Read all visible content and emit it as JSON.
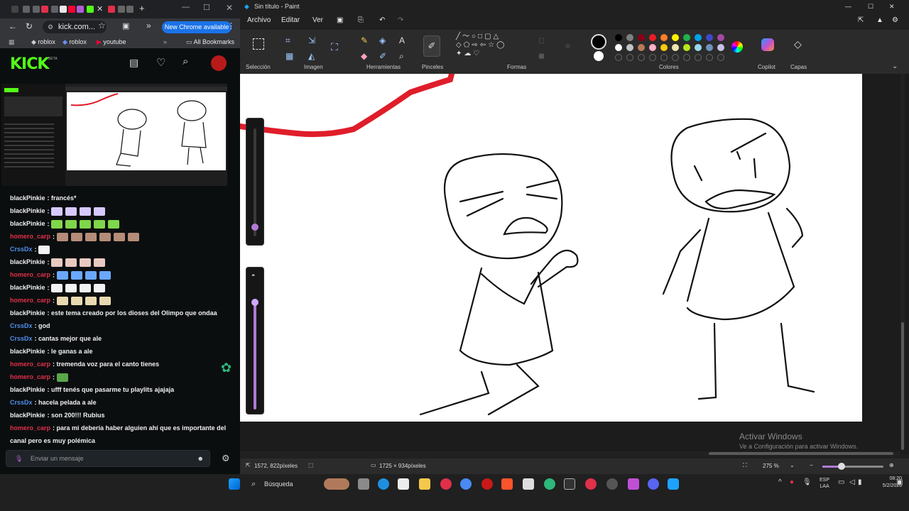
{
  "chrome": {
    "url": "kick.com...",
    "update_button": "New Chrome available",
    "bookmarks": [
      "roblox",
      "roblox",
      "youtube"
    ],
    "all_bookmarks": "All Bookmarks"
  },
  "kick": {
    "logo": "KICK",
    "beta": "BETA",
    "brand_color": "#53fc18",
    "chat_placeholder": "Enviar un mensaje",
    "messages": [
      {
        "user": "blackPinkie",
        "color": "#f0f0f0",
        "text": "francés*",
        "emotes": 0
      },
      {
        "user": "blackPinkie",
        "color": "#f0f0f0",
        "text": "",
        "emotes": 4,
        "emote_color": "#d6c9ff"
      },
      {
        "user": "blackPinkie",
        "color": "#f0f0f0",
        "text": "",
        "emotes": 5,
        "emote_color": "#7fd64a"
      },
      {
        "user": "homero_carp",
        "color": "#e0304a",
        "text": "",
        "emotes": 6,
        "emote_color": "#b48c78"
      },
      {
        "user": "CrssDx",
        "color": "#4f8fe8",
        "text": "",
        "emotes": 1,
        "emote_color": "#f2f2f2"
      },
      {
        "user": "blackPinkie",
        "color": "#f0f0f0",
        "text": "",
        "emotes": 4,
        "emote_color": "#e8c9c0"
      },
      {
        "user": "homero_carp",
        "color": "#e0304a",
        "text": "",
        "emotes": 4,
        "emote_color": "#6aa8ff"
      },
      {
        "user": "blackPinkie",
        "color": "#f0f0f0",
        "text": "",
        "emotes": 4,
        "emote_color": "#f2f2f2"
      },
      {
        "user": "homero_carp",
        "color": "#e0304a",
        "text": "",
        "emotes": 4,
        "emote_color": "#e8d9b0"
      },
      {
        "user": "blackPinkie",
        "color": "#f0f0f0",
        "text": "este tema creado por los dioses del Olimpo que ondaa",
        "emotes": 0
      },
      {
        "user": "CrssDx",
        "color": "#4f8fe8",
        "text": "god",
        "emotes": 0
      },
      {
        "user": "CrssDx",
        "color": "#4f8fe8",
        "text": "cantas mejor que ale",
        "emotes": 0
      },
      {
        "user": "blackPinkie",
        "color": "#f0f0f0",
        "text": "le ganas a ale",
        "emotes": 0
      },
      {
        "user": "homero_carp",
        "color": "#e0304a",
        "text": "tremenda voz para el canto tienes",
        "emotes": 0
      },
      {
        "user": "homero_carp",
        "color": "#e0304a",
        "text": "",
        "emotes": 1,
        "emote_color": "#5aa84a"
      },
      {
        "user": "blackPinkie",
        "color": "#f0f0f0",
        "text": "ufff tenés que pasarme tu playlits ajajaja",
        "emotes": 0
      },
      {
        "user": "CrssDx",
        "color": "#4f8fe8",
        "text": "hacela pelada a ale",
        "emotes": 0
      },
      {
        "user": "blackPinkie",
        "color": "#f0f0f0",
        "text": "son 200!!! Rubius",
        "emotes": 0
      },
      {
        "user": "homero_carp",
        "color": "#e0304a",
        "text": "para mi debería haber alguien ahí que es importante del",
        "emotes": 0
      },
      {
        "user": "",
        "color": "#f0f0f0",
        "text": "canal pero es muy polémica",
        "emotes": 0
      }
    ]
  },
  "paint": {
    "title": "Sin título - Paint",
    "menu": [
      "Archivo",
      "Editar",
      "Ver"
    ],
    "groups": [
      "Selección",
      "Imagen",
      "Herramientas",
      "Pinceles",
      "Formas",
      "Colores",
      "Copilot",
      "Capas"
    ],
    "palette": [
      "#000000",
      "#7f7f7f",
      "#880015",
      "#ed1c24",
      "#ff7f27",
      "#fff200",
      "#22b14c",
      "#00a2e8",
      "#3f48cc",
      "#a349a4",
      "#ffffff",
      "#c3c3c3",
      "#b97a57",
      "#ffaec9",
      "#ffc90e",
      "#efe4b0",
      "#b5e61d",
      "#99d9ea",
      "#7092be",
      "#c8bfe7"
    ],
    "status_position": "1572, 822píxeles",
    "status_size": "1725 × 934píxeles",
    "zoom": "275 %",
    "activate_title": "Activar Windows",
    "activate_text": "Ve a Configuración para activar Windows."
  },
  "taskbar": {
    "search": "Búsqueda",
    "lang": "ESP",
    "lang2": "LAA",
    "time": "08:20",
    "date": "5/2/2026"
  }
}
